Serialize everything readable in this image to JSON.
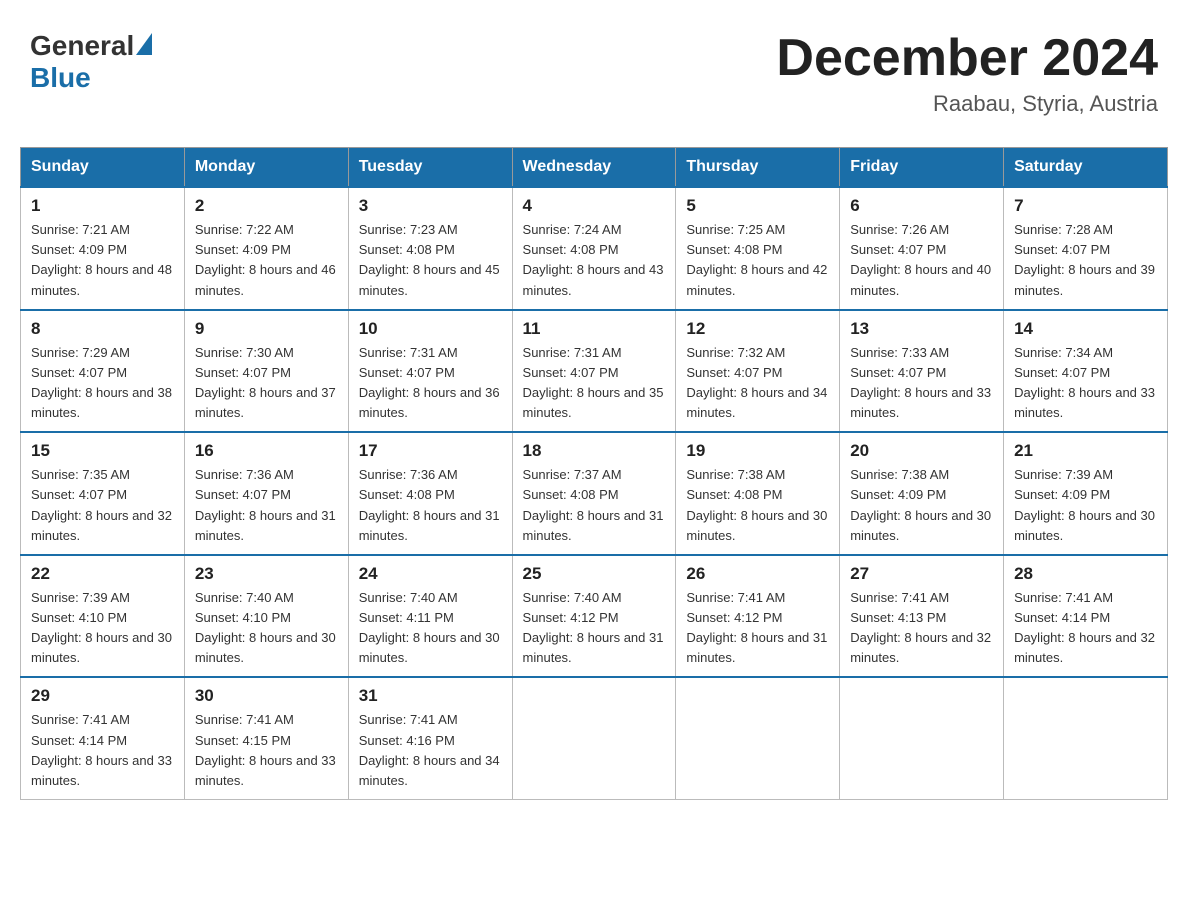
{
  "header": {
    "logo_general": "General",
    "logo_blue": "Blue",
    "month_title": "December 2024",
    "location": "Raabau, Styria, Austria"
  },
  "days_of_week": [
    "Sunday",
    "Monday",
    "Tuesday",
    "Wednesday",
    "Thursday",
    "Friday",
    "Saturday"
  ],
  "weeks": [
    [
      {
        "day": "1",
        "sunrise": "7:21 AM",
        "sunset": "4:09 PM",
        "daylight": "8 hours and 48 minutes."
      },
      {
        "day": "2",
        "sunrise": "7:22 AM",
        "sunset": "4:09 PM",
        "daylight": "8 hours and 46 minutes."
      },
      {
        "day": "3",
        "sunrise": "7:23 AM",
        "sunset": "4:08 PM",
        "daylight": "8 hours and 45 minutes."
      },
      {
        "day": "4",
        "sunrise": "7:24 AM",
        "sunset": "4:08 PM",
        "daylight": "8 hours and 43 minutes."
      },
      {
        "day": "5",
        "sunrise": "7:25 AM",
        "sunset": "4:08 PM",
        "daylight": "8 hours and 42 minutes."
      },
      {
        "day": "6",
        "sunrise": "7:26 AM",
        "sunset": "4:07 PM",
        "daylight": "8 hours and 40 minutes."
      },
      {
        "day": "7",
        "sunrise": "7:28 AM",
        "sunset": "4:07 PM",
        "daylight": "8 hours and 39 minutes."
      }
    ],
    [
      {
        "day": "8",
        "sunrise": "7:29 AM",
        "sunset": "4:07 PM",
        "daylight": "8 hours and 38 minutes."
      },
      {
        "day": "9",
        "sunrise": "7:30 AM",
        "sunset": "4:07 PM",
        "daylight": "8 hours and 37 minutes."
      },
      {
        "day": "10",
        "sunrise": "7:31 AM",
        "sunset": "4:07 PM",
        "daylight": "8 hours and 36 minutes."
      },
      {
        "day": "11",
        "sunrise": "7:31 AM",
        "sunset": "4:07 PM",
        "daylight": "8 hours and 35 minutes."
      },
      {
        "day": "12",
        "sunrise": "7:32 AM",
        "sunset": "4:07 PM",
        "daylight": "8 hours and 34 minutes."
      },
      {
        "day": "13",
        "sunrise": "7:33 AM",
        "sunset": "4:07 PM",
        "daylight": "8 hours and 33 minutes."
      },
      {
        "day": "14",
        "sunrise": "7:34 AM",
        "sunset": "4:07 PM",
        "daylight": "8 hours and 33 minutes."
      }
    ],
    [
      {
        "day": "15",
        "sunrise": "7:35 AM",
        "sunset": "4:07 PM",
        "daylight": "8 hours and 32 minutes."
      },
      {
        "day": "16",
        "sunrise": "7:36 AM",
        "sunset": "4:07 PM",
        "daylight": "8 hours and 31 minutes."
      },
      {
        "day": "17",
        "sunrise": "7:36 AM",
        "sunset": "4:08 PM",
        "daylight": "8 hours and 31 minutes."
      },
      {
        "day": "18",
        "sunrise": "7:37 AM",
        "sunset": "4:08 PM",
        "daylight": "8 hours and 31 minutes."
      },
      {
        "day": "19",
        "sunrise": "7:38 AM",
        "sunset": "4:08 PM",
        "daylight": "8 hours and 30 minutes."
      },
      {
        "day": "20",
        "sunrise": "7:38 AM",
        "sunset": "4:09 PM",
        "daylight": "8 hours and 30 minutes."
      },
      {
        "day": "21",
        "sunrise": "7:39 AM",
        "sunset": "4:09 PM",
        "daylight": "8 hours and 30 minutes."
      }
    ],
    [
      {
        "day": "22",
        "sunrise": "7:39 AM",
        "sunset": "4:10 PM",
        "daylight": "8 hours and 30 minutes."
      },
      {
        "day": "23",
        "sunrise": "7:40 AM",
        "sunset": "4:10 PM",
        "daylight": "8 hours and 30 minutes."
      },
      {
        "day": "24",
        "sunrise": "7:40 AM",
        "sunset": "4:11 PM",
        "daylight": "8 hours and 30 minutes."
      },
      {
        "day": "25",
        "sunrise": "7:40 AM",
        "sunset": "4:12 PM",
        "daylight": "8 hours and 31 minutes."
      },
      {
        "day": "26",
        "sunrise": "7:41 AM",
        "sunset": "4:12 PM",
        "daylight": "8 hours and 31 minutes."
      },
      {
        "day": "27",
        "sunrise": "7:41 AM",
        "sunset": "4:13 PM",
        "daylight": "8 hours and 32 minutes."
      },
      {
        "day": "28",
        "sunrise": "7:41 AM",
        "sunset": "4:14 PM",
        "daylight": "8 hours and 32 minutes."
      }
    ],
    [
      {
        "day": "29",
        "sunrise": "7:41 AM",
        "sunset": "4:14 PM",
        "daylight": "8 hours and 33 minutes."
      },
      {
        "day": "30",
        "sunrise": "7:41 AM",
        "sunset": "4:15 PM",
        "daylight": "8 hours and 33 minutes."
      },
      {
        "day": "31",
        "sunrise": "7:41 AM",
        "sunset": "4:16 PM",
        "daylight": "8 hours and 34 minutes."
      },
      null,
      null,
      null,
      null
    ]
  ]
}
